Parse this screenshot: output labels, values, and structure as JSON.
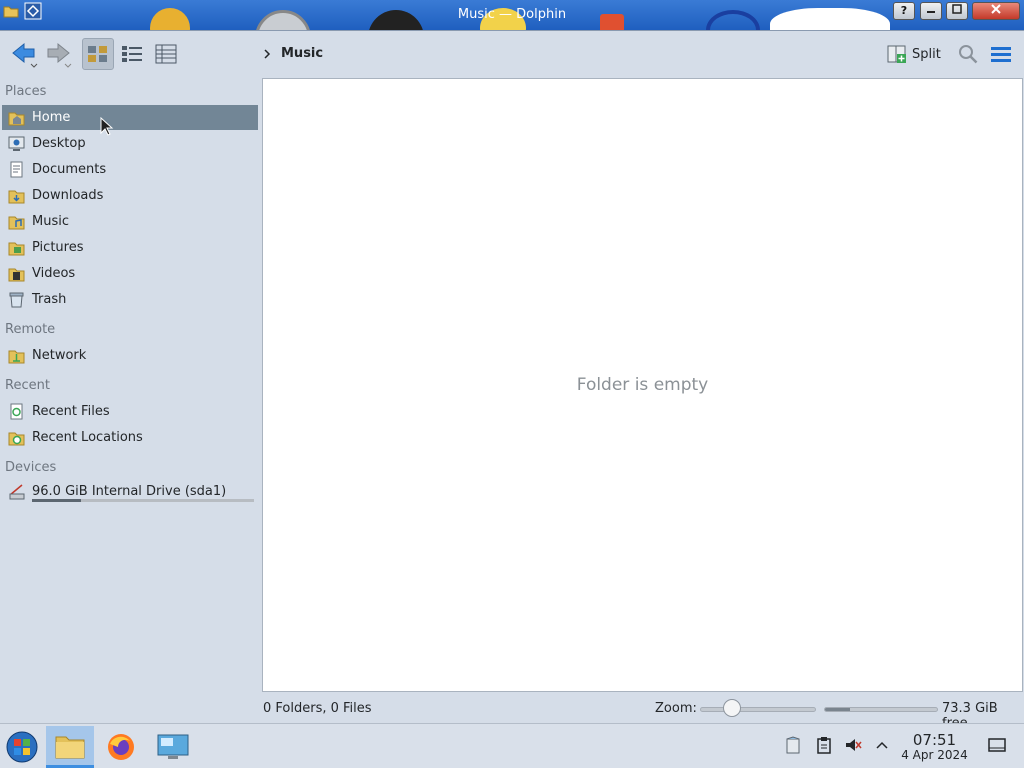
{
  "window": {
    "title": "Music — Dolphin",
    "help_label": "?"
  },
  "toolbar": {
    "breadcrumb": "Music",
    "split_label": "Split"
  },
  "sidebar": {
    "sections": [
      {
        "title": "Places",
        "items": [
          "Home",
          "Desktop",
          "Documents",
          "Downloads",
          "Music",
          "Pictures",
          "Videos",
          "Trash"
        ]
      },
      {
        "title": "Remote",
        "items": [
          "Network"
        ]
      },
      {
        "title": "Recent",
        "items": [
          "Recent Files",
          "Recent Locations"
        ]
      },
      {
        "title": "Devices",
        "items": [
          "96.0 GiB Internal Drive (sda1)"
        ]
      }
    ],
    "selected": "Home",
    "drive_used_fraction": 0.22
  },
  "view": {
    "empty_text": "Folder is empty"
  },
  "status": {
    "summary": "0 Folders, 0 Files",
    "zoom_label": "Zoom:",
    "zoom_fraction": 0.28,
    "space_used_fraction": 0.22,
    "free_space": "73.3 GiB free"
  },
  "taskbar": {
    "time": "07:51",
    "date": "4 Apr 2024"
  },
  "colors": {
    "accent": "#3d8ee0",
    "selection": "#728696",
    "icon_blue": "#1e6fd0"
  }
}
